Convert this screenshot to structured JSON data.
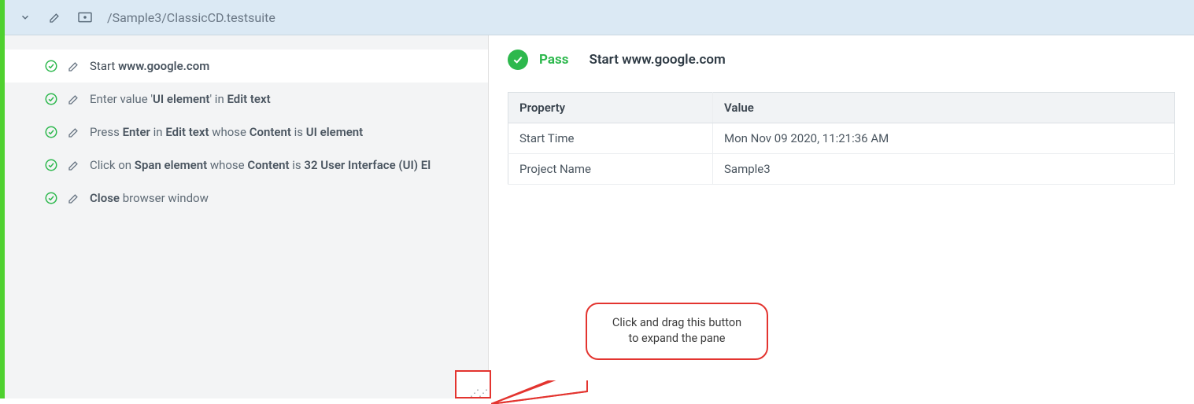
{
  "header": {
    "path": "/Sample3/ClassicCD.testsuite"
  },
  "steps": [
    {
      "html": "Start <b>www.google.com</b>"
    },
    {
      "html": "Enter value '<b>UI element</b>' in <b>Edit text</b>"
    },
    {
      "html": "Press <b>Enter</b> in <b>Edit text</b> whose <b>Content</b> is <b>UI element</b>"
    },
    {
      "html": "Click on <b>Span element</b> whose <b>Content</b> is <b>32 User Interface (UI) El</b>"
    },
    {
      "html": "<b>Close</b> browser window"
    }
  ],
  "detail": {
    "status": "Pass",
    "title": "Start www.google.com",
    "table": {
      "headers": {
        "prop": "Property",
        "val": "Value"
      },
      "rows": [
        {
          "prop": "Start Time",
          "val": "Mon Nov 09 2020, 11:21:36 AM"
        },
        {
          "prop": "Project Name",
          "val": "Sample3"
        }
      ]
    }
  },
  "callout": {
    "line1": "Click and drag this button",
    "line2": "to expand the pane"
  }
}
